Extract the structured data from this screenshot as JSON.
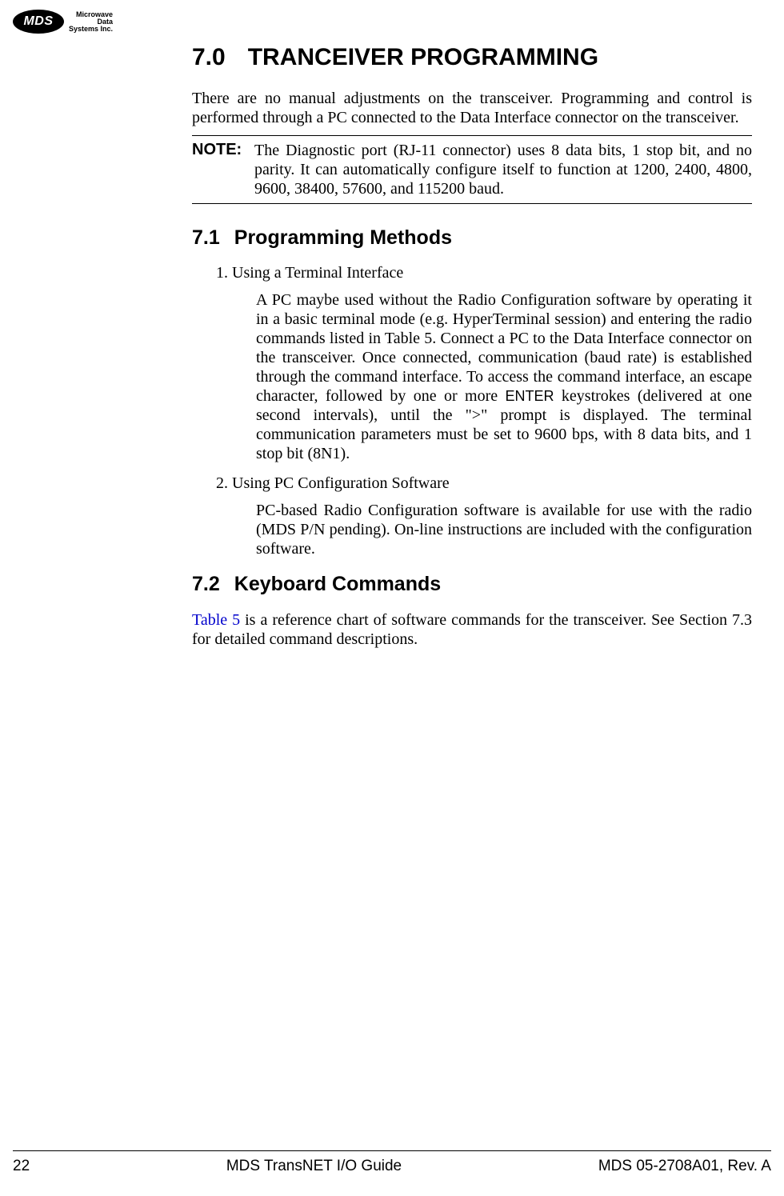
{
  "logo": {
    "mark": "MDS",
    "line1": "Microwave",
    "line2": "Data",
    "line3": "Systems Inc."
  },
  "section7": {
    "num": "7.0",
    "title": "TRANCEIVER PROGRAMMING",
    "intro": "There are no manual adjustments on the transceiver. Programming and control is performed through a PC connected to the Data Interface connector on the transceiver."
  },
  "note": {
    "label": "NOTE:",
    "text": "The Diagnostic port (RJ-11 connector) uses 8 data bits, 1 stop bit, and no parity. It can automatically configure itself to function at 1200, 2400, 4800, 9600, 38400, 57600, and 115200 baud."
  },
  "section71": {
    "num": "7.1",
    "title": "Programming Methods",
    "item1_title": "1. Using a Terminal Interface",
    "item1_body_a": "A PC maybe used without the Radio Configuration software by operating it in a basic terminal mode (e.g. HyperTerminal session) and entering the radio commands listed in Table 5. Connect a PC to the Data Interface connector on the transceiver. Once connected, communication (baud rate) is established through the command interface. To access the command interface, an escape character, followed by one or more ",
    "item1_enter": "ENTER",
    "item1_body_b": " keystrokes (delivered at one second intervals), until the \">\" prompt is displayed. The terminal communication parameters must be set to 9600 bps, with 8 data bits, and 1 stop bit (8N1).",
    "item2_title": "2. Using PC Configuration Software",
    "item2_body": "PC-based Radio Configuration software is available for use with the radio (MDS P/N pending). On-line instructions are included with the configuration software."
  },
  "section72": {
    "num": "7.2",
    "title": "Keyboard Commands",
    "xref": "Table 5",
    "text": " is a reference chart of software commands for the transceiver. See Section 7.3 for detailed command descriptions."
  },
  "footer": {
    "page": "22",
    "center": "MDS TransNET I/O Guide",
    "right": "MDS 05-2708A01, Rev. A"
  }
}
